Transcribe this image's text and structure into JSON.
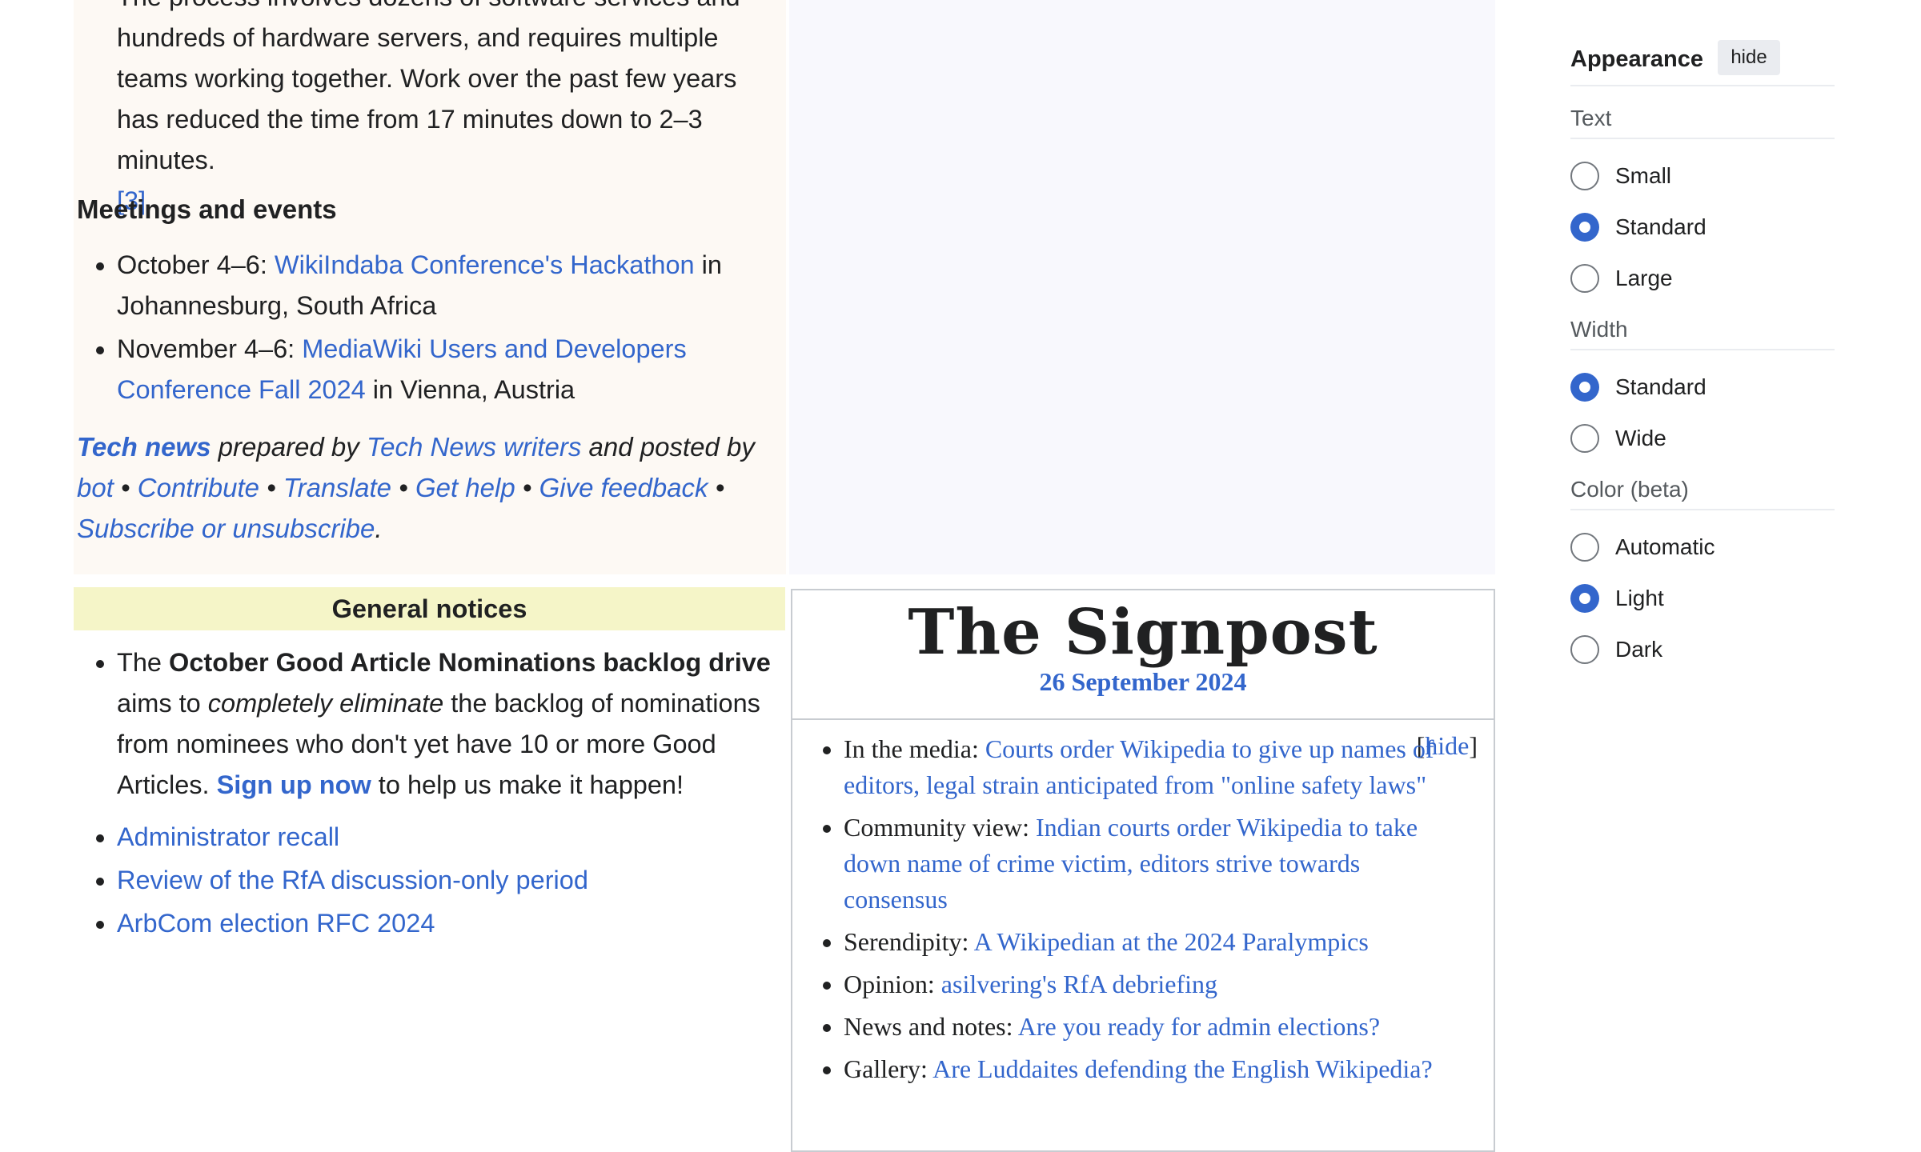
{
  "tech_news": {
    "partial_paragraph": "The process involves dozens of software services and hundreds of hardware servers, and requires multiple teams working together. Work over the past few years has reduced the time from 17 minutes down to 2–3 minutes.",
    "ref": "[3]",
    "meetings_heading": "Meetings and events",
    "meetings": [
      {
        "prefix": "October 4–6: ",
        "link": "WikiIndaba Conference's Hackathon",
        "suffix": " in Johannesburg, South Africa"
      },
      {
        "prefix": "November 4–6: ",
        "link": "MediaWiki Users and Developers Conference Fall 2024",
        "suffix": " in Vienna, Austria"
      }
    ],
    "footer": {
      "tech_news": "Tech news",
      "prepared_by": " prepared by ",
      "writers": "Tech News writers",
      "posted_by": " and posted by ",
      "bot": "bot",
      "sep": " • ",
      "contribute": "Contribute",
      "translate": "Translate",
      "get_help": "Get help",
      "give_feedback": "Give feedback",
      "subscribe": "Subscribe or unsubscribe",
      "end": "."
    }
  },
  "general_notices": {
    "heading": "General notices",
    "drive": {
      "the": "The ",
      "bold": "October Good Article Nominations backlog drive",
      "aims": " aims to ",
      "italic": "completely eliminate",
      "rest": " the backlog of nominations from nominees who don't yet have 10 or more Good Articles. ",
      "signup": "Sign up now",
      "end": " to help us make it happen!"
    },
    "links": [
      "Administrator recall",
      "Review of the RfA discussion-only period",
      "ArbCom election RFC 2024"
    ]
  },
  "signpost": {
    "title": "The Signpost",
    "date": "26 September 2024",
    "hide_open": "[",
    "hide": "hide",
    "hide_close": "]",
    "items": [
      {
        "label": "In the media: ",
        "link": "Courts order Wikipedia to give up names of editors, legal strain anticipated from \"online safety laws\""
      },
      {
        "label": "Community view: ",
        "link": "Indian courts order Wikipedia to take down name of crime victim, editors strive towards consensus"
      },
      {
        "label": "Serendipity: ",
        "link": "A Wikipedian at the 2024 Paralympics"
      },
      {
        "label": "Opinion: ",
        "link": "asilvering's RfA debriefing"
      },
      {
        "label": "News and notes: ",
        "link": "Are you ready for admin elections?"
      },
      {
        "label": "Gallery: ",
        "link": "Are Luddaites defending the English Wikipedia?"
      }
    ]
  },
  "appearance": {
    "title": "Appearance",
    "hide": "hide",
    "text_label": "Text",
    "text_options": [
      "Small",
      "Standard",
      "Large"
    ],
    "text_selected": "Standard",
    "width_label": "Width",
    "width_options": [
      "Standard",
      "Wide"
    ],
    "width_selected": "Standard",
    "color_label": "Color (beta)",
    "color_options": [
      "Automatic",
      "Light",
      "Dark"
    ],
    "color_selected": "Light",
    "accent_color": "#3366cc"
  }
}
